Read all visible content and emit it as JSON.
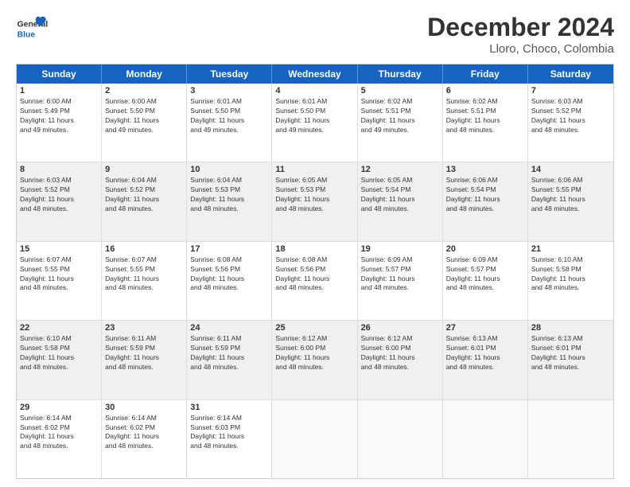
{
  "header": {
    "logo_general": "General",
    "logo_blue": "Blue",
    "main_title": "December 2024",
    "subtitle": "Lloro, Choco, Colombia"
  },
  "calendar": {
    "days_of_week": [
      "Sunday",
      "Monday",
      "Tuesday",
      "Wednesday",
      "Thursday",
      "Friday",
      "Saturday"
    ],
    "weeks": [
      [
        {
          "day": "",
          "empty": true
        },
        {
          "day": "",
          "empty": true
        },
        {
          "day": "",
          "empty": true
        },
        {
          "day": "",
          "empty": true
        },
        {
          "day": "",
          "empty": true
        },
        {
          "day": "",
          "empty": true
        },
        {
          "day": "",
          "empty": true
        }
      ]
    ]
  },
  "weeks": [
    {
      "cells": [
        {
          "num": "1",
          "info": "Sunrise: 6:00 AM\nSunset: 5:49 PM\nDaylight: 11 hours\nand 49 minutes.",
          "shade": false
        },
        {
          "num": "2",
          "info": "Sunrise: 6:00 AM\nSunset: 5:50 PM\nDaylight: 11 hours\nand 49 minutes.",
          "shade": false
        },
        {
          "num": "3",
          "info": "Sunrise: 6:01 AM\nSunset: 5:50 PM\nDaylight: 11 hours\nand 49 minutes.",
          "shade": false
        },
        {
          "num": "4",
          "info": "Sunrise: 6:01 AM\nSunset: 5:50 PM\nDaylight: 11 hours\nand 49 minutes.",
          "shade": false
        },
        {
          "num": "5",
          "info": "Sunrise: 6:02 AM\nSunset: 5:51 PM\nDaylight: 11 hours\nand 49 minutes.",
          "shade": false
        },
        {
          "num": "6",
          "info": "Sunrise: 6:02 AM\nSunset: 5:51 PM\nDaylight: 11 hours\nand 48 minutes.",
          "shade": false
        },
        {
          "num": "7",
          "info": "Sunrise: 6:03 AM\nSunset: 5:52 PM\nDaylight: 11 hours\nand 48 minutes.",
          "shade": false
        }
      ]
    },
    {
      "cells": [
        {
          "num": "8",
          "info": "Sunrise: 6:03 AM\nSunset: 5:52 PM\nDaylight: 11 hours\nand 48 minutes.",
          "shade": true
        },
        {
          "num": "9",
          "info": "Sunrise: 6:04 AM\nSunset: 5:52 PM\nDaylight: 11 hours\nand 48 minutes.",
          "shade": true
        },
        {
          "num": "10",
          "info": "Sunrise: 6:04 AM\nSunset: 5:53 PM\nDaylight: 11 hours\nand 48 minutes.",
          "shade": true
        },
        {
          "num": "11",
          "info": "Sunrise: 6:05 AM\nSunset: 5:53 PM\nDaylight: 11 hours\nand 48 minutes.",
          "shade": true
        },
        {
          "num": "12",
          "info": "Sunrise: 6:05 AM\nSunset: 5:54 PM\nDaylight: 11 hours\nand 48 minutes.",
          "shade": true
        },
        {
          "num": "13",
          "info": "Sunrise: 6:06 AM\nSunset: 5:54 PM\nDaylight: 11 hours\nand 48 minutes.",
          "shade": true
        },
        {
          "num": "14",
          "info": "Sunrise: 6:06 AM\nSunset: 5:55 PM\nDaylight: 11 hours\nand 48 minutes.",
          "shade": true
        }
      ]
    },
    {
      "cells": [
        {
          "num": "15",
          "info": "Sunrise: 6:07 AM\nSunset: 5:55 PM\nDaylight: 11 hours\nand 48 minutes.",
          "shade": false
        },
        {
          "num": "16",
          "info": "Sunrise: 6:07 AM\nSunset: 5:55 PM\nDaylight: 11 hours\nand 48 minutes.",
          "shade": false
        },
        {
          "num": "17",
          "info": "Sunrise: 6:08 AM\nSunset: 5:56 PM\nDaylight: 11 hours\nand 48 minutes.",
          "shade": false
        },
        {
          "num": "18",
          "info": "Sunrise: 6:08 AM\nSunset: 5:56 PM\nDaylight: 11 hours\nand 48 minutes.",
          "shade": false
        },
        {
          "num": "19",
          "info": "Sunrise: 6:09 AM\nSunset: 5:57 PM\nDaylight: 11 hours\nand 48 minutes.",
          "shade": false
        },
        {
          "num": "20",
          "info": "Sunrise: 6:09 AM\nSunset: 5:57 PM\nDaylight: 11 hours\nand 48 minutes.",
          "shade": false
        },
        {
          "num": "21",
          "info": "Sunrise: 6:10 AM\nSunset: 5:58 PM\nDaylight: 11 hours\nand 48 minutes.",
          "shade": false
        }
      ]
    },
    {
      "cells": [
        {
          "num": "22",
          "info": "Sunrise: 6:10 AM\nSunset: 5:58 PM\nDaylight: 11 hours\nand 48 minutes.",
          "shade": true
        },
        {
          "num": "23",
          "info": "Sunrise: 6:11 AM\nSunset: 5:59 PM\nDaylight: 11 hours\nand 48 minutes.",
          "shade": true
        },
        {
          "num": "24",
          "info": "Sunrise: 6:11 AM\nSunset: 5:59 PM\nDaylight: 11 hours\nand 48 minutes.",
          "shade": true
        },
        {
          "num": "25",
          "info": "Sunrise: 6:12 AM\nSunset: 6:00 PM\nDaylight: 11 hours\nand 48 minutes.",
          "shade": true
        },
        {
          "num": "26",
          "info": "Sunrise: 6:12 AM\nSunset: 6:00 PM\nDaylight: 11 hours\nand 48 minutes.",
          "shade": true
        },
        {
          "num": "27",
          "info": "Sunrise: 6:13 AM\nSunset: 6:01 PM\nDaylight: 11 hours\nand 48 minutes.",
          "shade": true
        },
        {
          "num": "28",
          "info": "Sunrise: 6:13 AM\nSunset: 6:01 PM\nDaylight: 11 hours\nand 48 minutes.",
          "shade": true
        }
      ]
    },
    {
      "cells": [
        {
          "num": "29",
          "info": "Sunrise: 6:14 AM\nSunset: 6:02 PM\nDaylight: 11 hours\nand 48 minutes.",
          "shade": false
        },
        {
          "num": "30",
          "info": "Sunrise: 6:14 AM\nSunset: 6:02 PM\nDaylight: 11 hours\nand 48 minutes.",
          "shade": false
        },
        {
          "num": "31",
          "info": "Sunrise: 6:14 AM\nSunset: 6:03 PM\nDaylight: 11 hours\nand 48 minutes.",
          "shade": false
        },
        {
          "num": "",
          "info": "",
          "empty": true
        },
        {
          "num": "",
          "info": "",
          "empty": true
        },
        {
          "num": "",
          "info": "",
          "empty": true
        },
        {
          "num": "",
          "info": "",
          "empty": true
        }
      ]
    }
  ],
  "dow": [
    "Sunday",
    "Monday",
    "Tuesday",
    "Wednesday",
    "Thursday",
    "Friday",
    "Saturday"
  ]
}
